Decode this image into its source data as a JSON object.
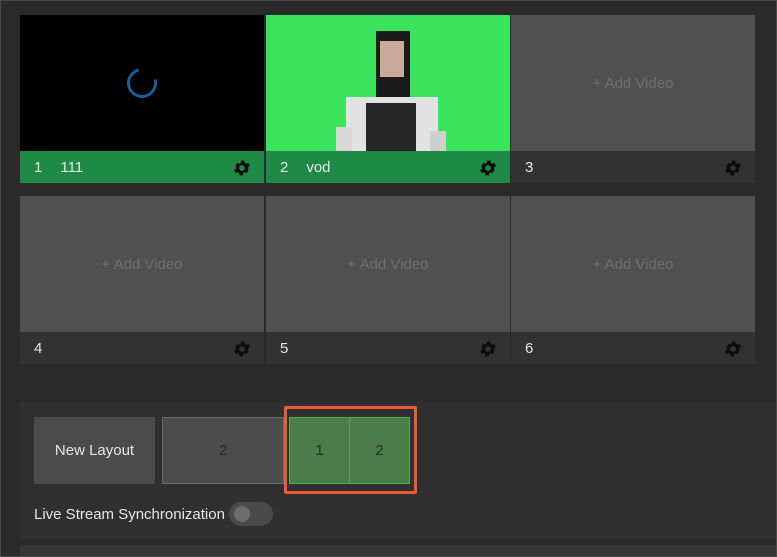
{
  "tiles": [
    {
      "index": "1",
      "name": "111",
      "state": "loading",
      "active": true
    },
    {
      "index": "2",
      "name": "vod",
      "state": "video",
      "active": true
    },
    {
      "index": "3",
      "name": "",
      "state": "empty",
      "active": false,
      "add_label": "+ Add Video"
    },
    {
      "index": "4",
      "name": "",
      "state": "empty",
      "active": false,
      "add_label": "+ Add Video"
    },
    {
      "index": "5",
      "name": "",
      "state": "empty",
      "active": false,
      "add_label": "+ Add Video"
    },
    {
      "index": "6",
      "name": "",
      "state": "empty",
      "active": false,
      "add_label": "+ Add Video"
    }
  ],
  "layout_panel": {
    "new_layout_label": "New Layout",
    "layouts": [
      {
        "cells": [
          "2"
        ],
        "selected": false
      },
      {
        "cells": [
          "1",
          "2"
        ],
        "selected": true
      }
    ],
    "sync_label": "Live Stream Synchronization",
    "sync_enabled": false
  },
  "colors": {
    "active_bar": "#1f8a45",
    "green_screen": "#3be45d",
    "highlight": "#f05a3a",
    "selected_layout": "#4a7d49"
  },
  "icons": [
    "loading-spinner-icon",
    "gear-icon"
  ]
}
